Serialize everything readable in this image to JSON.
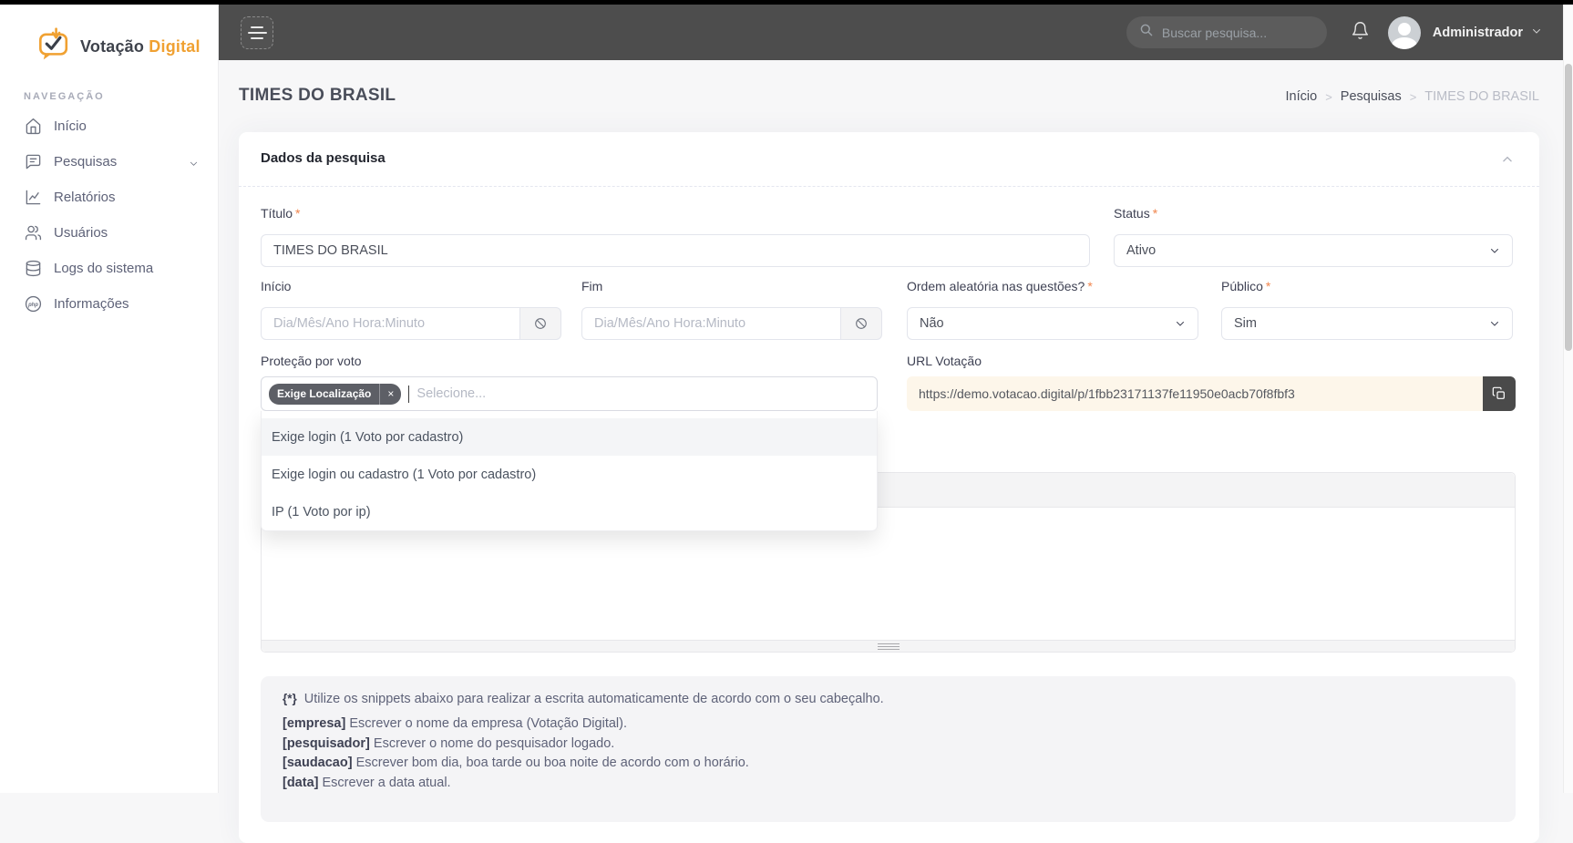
{
  "ui": {
    "required_marker": "*",
    "breadcrumb_separator": ">"
  },
  "brand": {
    "name_primary": "Votação",
    "name_secondary": "Digital"
  },
  "sidebar": {
    "section_label": "NAVEGAÇÃO",
    "items": [
      {
        "label": "Início",
        "icon": "home-icon"
      },
      {
        "label": "Pesquisas",
        "icon": "survey-icon",
        "expandable": true
      },
      {
        "label": "Relatórios",
        "icon": "reports-icon"
      },
      {
        "label": "Usuários",
        "icon": "users-icon"
      },
      {
        "label": "Logs do sistema",
        "icon": "database-icon"
      },
      {
        "label": "Informações",
        "icon": "php-icon"
      }
    ]
  },
  "topbar": {
    "search_placeholder": "Buscar pesquisa...",
    "user_name": "Administrador"
  },
  "page": {
    "title": "TIMES DO BRASIL",
    "breadcrumb": [
      "Início",
      "Pesquisas",
      "TIMES DO BRASIL"
    ]
  },
  "card": {
    "title": "Dados da pesquisa"
  },
  "form": {
    "titulo": {
      "label": "Título",
      "value": "TIMES DO BRASIL"
    },
    "status": {
      "label": "Status",
      "value": "Ativo"
    },
    "inicio": {
      "label": "Início",
      "placeholder": "Dia/Mês/Ano Hora:Minuto"
    },
    "fim": {
      "label": "Fim",
      "placeholder": "Dia/Mês/Ano Hora:Minuto"
    },
    "ordem": {
      "label": "Ordem aleatória nas questões?",
      "value": "Não"
    },
    "publico": {
      "label": "Público",
      "value": "Sim"
    },
    "protecao": {
      "label": "Proteção por voto",
      "selected_tag": "Exige Localização",
      "tag_remove": "×",
      "placeholder": "Selecione...",
      "options": [
        "Exige login (1 Voto por cadastro)",
        "Exige login ou cadastro (1 Voto por cadastro)",
        "IP (1 Voto por ip)"
      ]
    },
    "url": {
      "label": "URL Votação",
      "value": "https://demo.votacao.digital/p/1fbb23171137fe11950e0acb70f8fbf3"
    }
  },
  "snippets": {
    "icon_text": "{*}",
    "intro": "Utilize os snippets abaixo para realizar a escrita automaticamente de acordo com o seu cabeçalho.",
    "items": [
      {
        "token": "[empresa]",
        "text": "Escrever o nome da empresa (Votação Digital)."
      },
      {
        "token": "[pesquisador]",
        "text": "Escrever o nome do pesquisador logado."
      },
      {
        "token": "[saudacao]",
        "text": "Escrever bom dia, boa tarde ou boa noite de acordo com o horário."
      },
      {
        "token": "[data]",
        "text": "Escrever a data atual."
      }
    ]
  },
  "colors": {
    "brand_orange": "#f0a132",
    "topbar_bg": "#4d4d4d",
    "required_marker": "#f0854d",
    "url_field_bg": "#fdf6ea",
    "tag_bg": "#5d5f66",
    "dark_button": "#4a4a4a",
    "page_bg": "#f7f7f8"
  }
}
